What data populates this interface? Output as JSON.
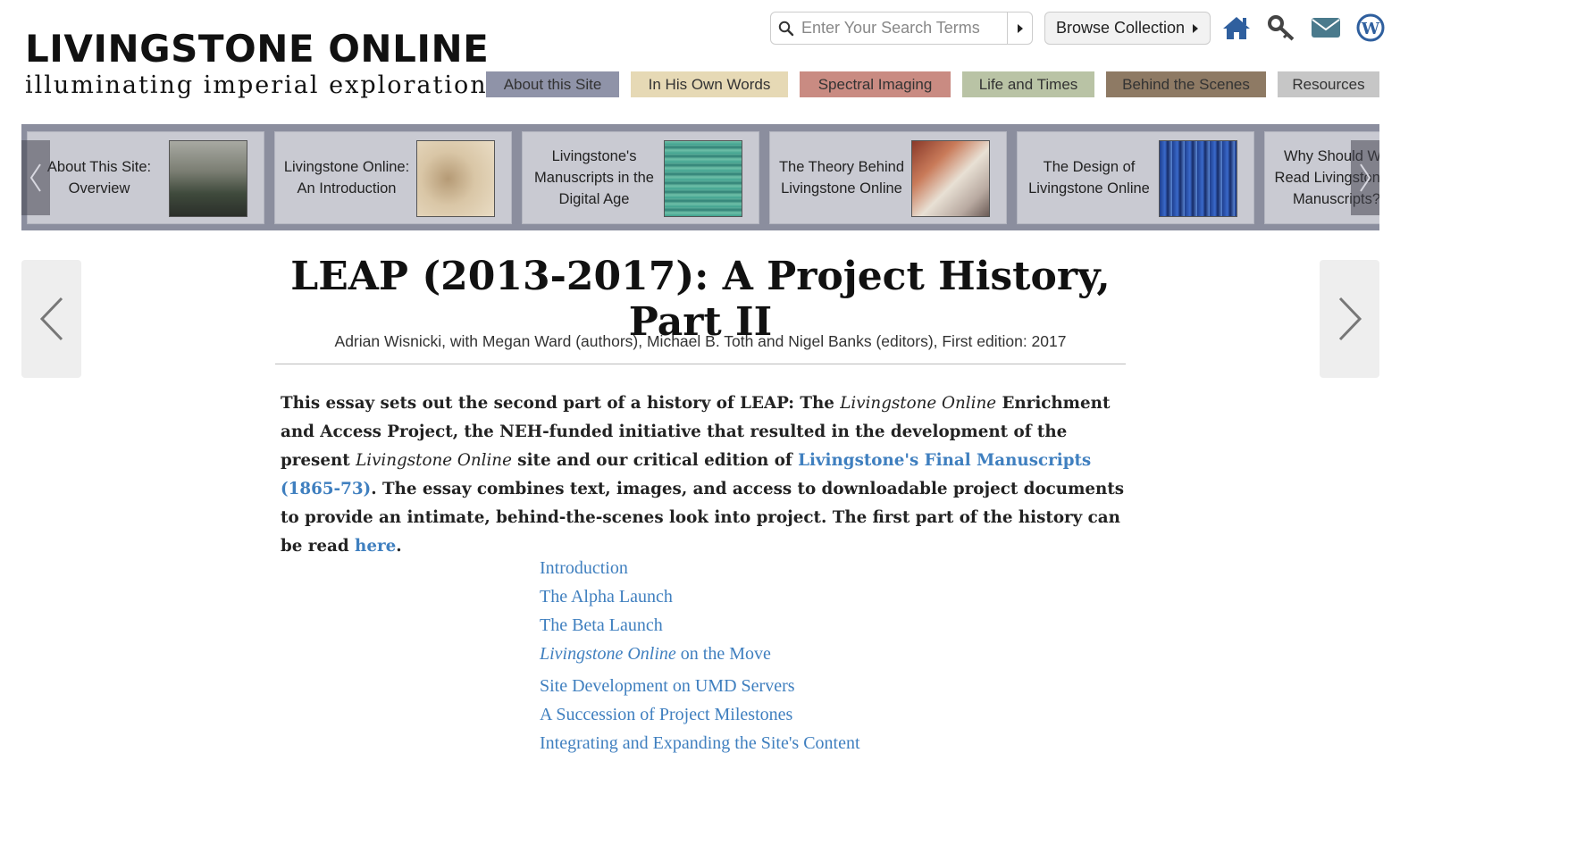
{
  "logo": {
    "title": "LIVINGSTONE ONLINE",
    "subtitle": "illuminating imperial exploration"
  },
  "search": {
    "placeholder": "Enter Your Search Terms",
    "browse_label": "Browse Collection"
  },
  "top_icons": [
    "home-icon",
    "key-icon",
    "envelope-icon",
    "wordpress-icon"
  ],
  "nav": {
    "tabs": [
      {
        "label": "About this Site",
        "color": "#8f93a8"
      },
      {
        "label": "In His Own Words",
        "color": "#e6d9b5"
      },
      {
        "label": "Spectral Imaging",
        "color": "#c98b82"
      },
      {
        "label": "Life and Times",
        "color": "#b9c3a5"
      },
      {
        "label": "Behind the Scenes",
        "color": "#8e7a64"
      },
      {
        "label": "Resources",
        "color": "#c6c6c6"
      }
    ]
  },
  "carousel": {
    "items": [
      {
        "label": "About This Site: Overview"
      },
      {
        "label": "Livingstone Online: An Introduction"
      },
      {
        "label": "Livingstone's Manuscripts in the Digital Age"
      },
      {
        "label": "The Theory Behind Livingstone Online"
      },
      {
        "label": "The Design of Livingstone Online"
      },
      {
        "label": "Why Should We Read Livingstone's Manuscripts?"
      }
    ]
  },
  "article": {
    "title": "LEAP (2013-2017): A Project History, Part II",
    "byline": "Adrian Wisnicki, with Megan Ward (authors), Michael B. Toth and Nigel Banks (editors), First edition: 2017",
    "intro": {
      "p1": "This essay sets out the second part of a history of LEAP: The ",
      "em1": "Livingstone Online",
      "p2": " Enrichment and Access Project, the NEH-funded initiative that resulted in the development of the present ",
      "em2": "Livingstone Online",
      "p3": " site and our critical edition of ",
      "link1": "Livingstone's Final Manuscripts (1865-73)",
      "p4": ". The essay combines text, images, and access to downloadable project documents to provide an intimate, behind-the-scenes look into project. The first part of the history can be read ",
      "link2": "here",
      "p5": "."
    },
    "toc": {
      "introduction": "Introduction",
      "alpha": "The Alpha Launch",
      "beta": "The Beta Launch",
      "move_em": "Livingstone Online",
      "move_rest": " on the Move",
      "umd": "Site Development on UMD Servers",
      "milestones": "A Succession of Project Milestones",
      "integrating": "Integrating and Expanding the Site's Content"
    }
  },
  "colors": {
    "link": "#3f7fbf",
    "carousel_bg": "#8b8e9e",
    "card_bg": "#c9cad2"
  }
}
